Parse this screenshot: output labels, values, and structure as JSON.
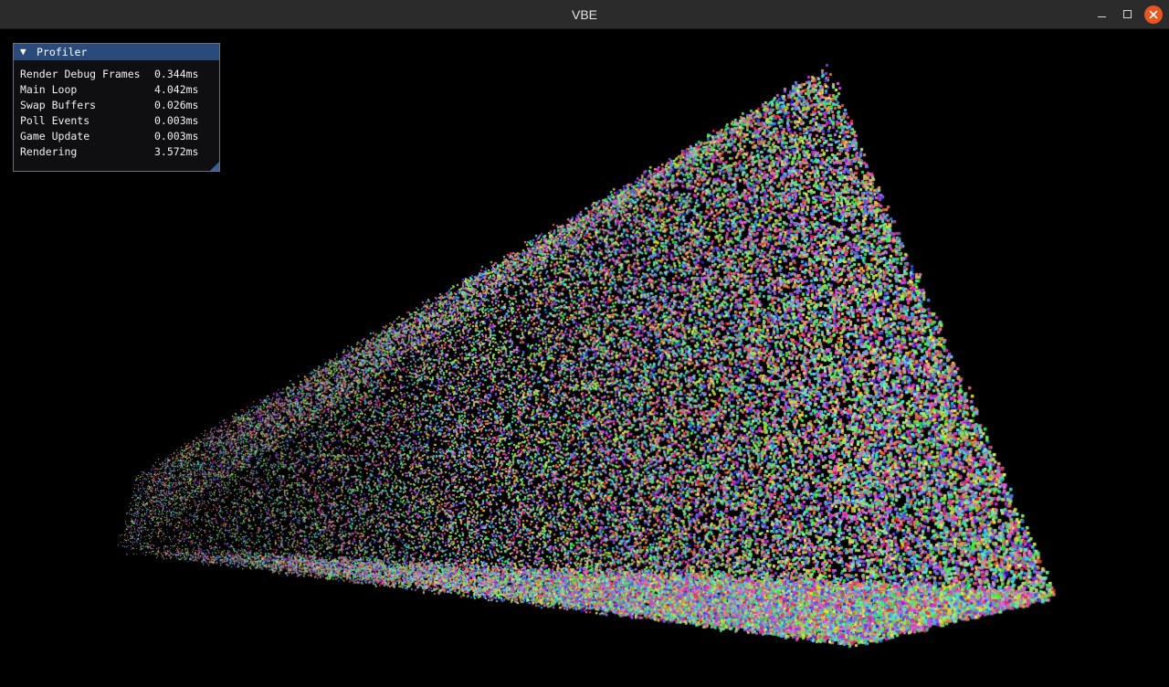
{
  "window": {
    "title": "VBE"
  },
  "profiler": {
    "title": "Profiler",
    "rows": [
      {
        "label": "Render Debug Frames",
        "value": "0.344ms"
      },
      {
        "label": "Main Loop",
        "value": "4.042ms"
      },
      {
        "label": "Swap Buffers",
        "value": "0.026ms"
      },
      {
        "label": "Poll Events",
        "value": "0.003ms"
      },
      {
        "label": "Game Update",
        "value": "0.003ms"
      },
      {
        "label": "Rendering",
        "value": "3.572ms"
      }
    ]
  },
  "icons": {
    "minimize": "minimize-icon",
    "maximize": "maximize-icon",
    "close": "close-icon",
    "collapse": "triangle-down-icon"
  },
  "colors": {
    "titlebar": "#2b2b2b",
    "close_button": "#e95420",
    "profiler_header": "#294a7a",
    "viewport_bg": "#000000"
  }
}
